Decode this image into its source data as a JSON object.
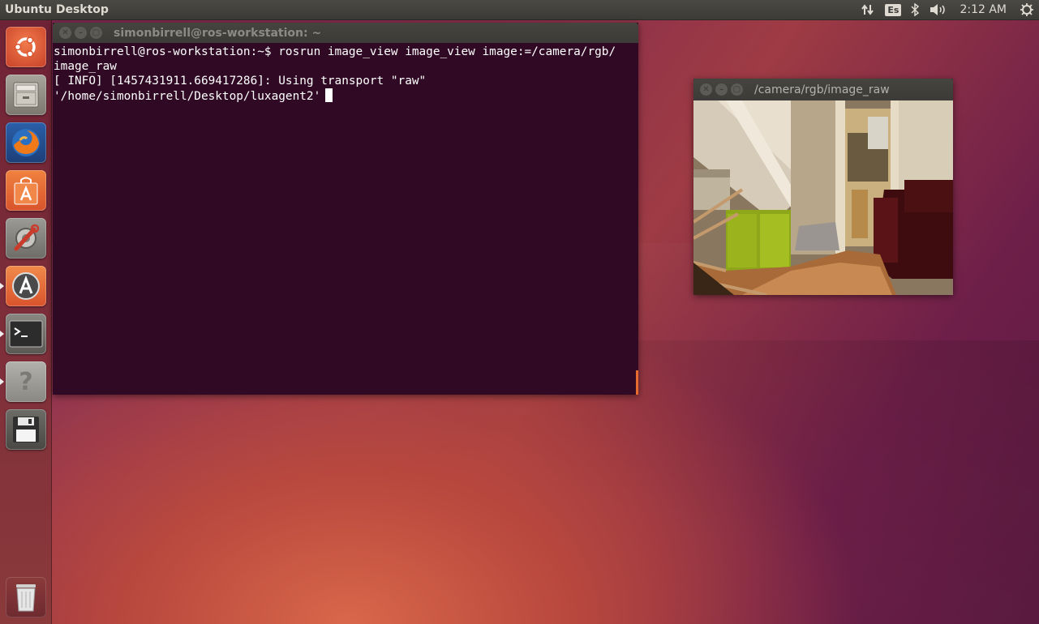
{
  "top_panel": {
    "title": "Ubuntu Desktop",
    "indicators": {
      "network_icon": "network-updown-icon",
      "keyboard_layout": "Es",
      "bluetooth_icon": "bluetooth-icon",
      "sound_icon": "speaker-volume-icon",
      "clock": "2:12 AM",
      "session_icon": "gear-power-icon"
    }
  },
  "launcher": {
    "items": [
      {
        "name": "ubuntu-dash",
        "icon": "ubuntu-logo-icon"
      },
      {
        "name": "files",
        "icon": "file-cabinet-icon"
      },
      {
        "name": "firefox",
        "icon": "firefox-icon"
      },
      {
        "name": "ubuntu-software-center",
        "icon": "shopping-bag-icon"
      },
      {
        "name": "system-settings",
        "icon": "settings-wrench-icon"
      },
      {
        "name": "software-updater",
        "icon": "updater-icon",
        "running": true
      },
      {
        "name": "terminal",
        "icon": "terminal-icon",
        "running": true
      },
      {
        "name": "help",
        "icon": "help-icon",
        "running": true
      },
      {
        "name": "save-disk",
        "icon": "floppy-disk-icon"
      },
      {
        "name": "trash",
        "icon": "trash-icon"
      }
    ]
  },
  "terminal": {
    "title": "simonbirrell@ros-workstation: ~",
    "lines": [
      "simonbirrell@ros-workstation:~$ rosrun image_view image_view image:=/camera/rgb/",
      "image_raw",
      "[ INFO] [1457431911.669417286]: Using transport \"raw\"",
      "'/home/simonbirrell/Desktop/luxagent2'"
    ]
  },
  "image_window": {
    "title": "/camera/rgb/image_raw"
  },
  "colors": {
    "terminal_bg": "#300a24",
    "panel_bg": "#3c3b37",
    "accent": "#e56b2f"
  }
}
